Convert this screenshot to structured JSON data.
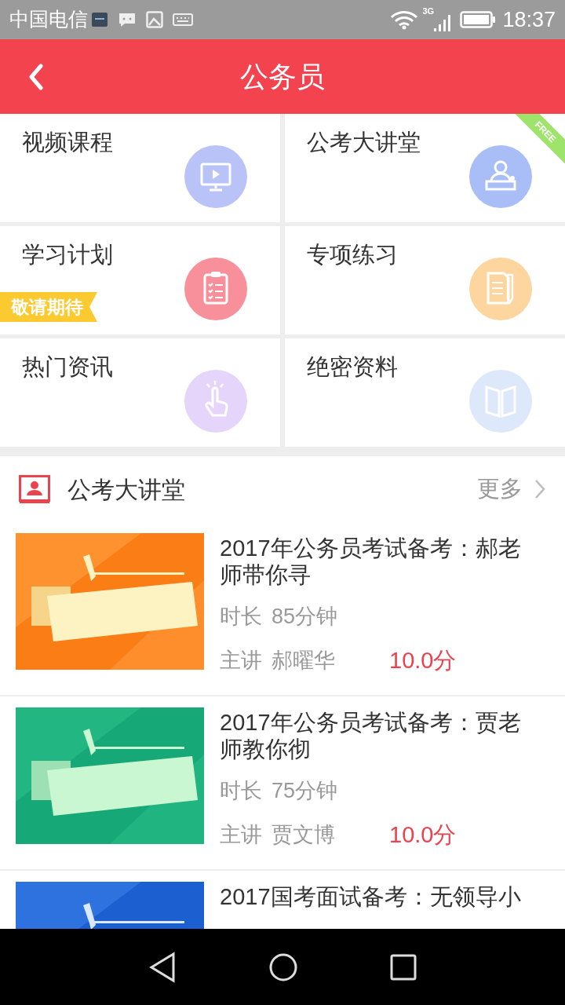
{
  "status_bar": {
    "carrier": "中国电信",
    "network": "3G",
    "time": "18:37"
  },
  "header": {
    "title": "公务员"
  },
  "grid": [
    {
      "label": "视频课程",
      "color": "#b9c3f7"
    },
    {
      "label": "公考大讲堂",
      "color": "#a9bdf6",
      "badge": {
        "kind": "corner",
        "text": "FREE"
      }
    },
    {
      "label": "学习计划",
      "color": "#f7909a",
      "badge": {
        "kind": "ribbon",
        "text": "敬请期待"
      }
    },
    {
      "label": "专项练习",
      "color": "#fdd59f"
    },
    {
      "label": "热门资讯",
      "color": "#e6d5fb"
    },
    {
      "label": "绝密资料",
      "color": "#dde9fb"
    }
  ],
  "section": {
    "title": "公考大讲堂",
    "more": "更多"
  },
  "courses": [
    {
      "title": "2017年公务员考试备考：郝老师带你寻",
      "duration_label": "时长",
      "duration": "85分钟",
      "teacher_label": "主讲",
      "teacher": "郝曜华",
      "score": "10.0分"
    },
    {
      "title": "2017年公务员考试备考：贾老师教你彻",
      "duration_label": "时长",
      "duration": "75分钟",
      "teacher_label": "主讲",
      "teacher": "贾文博",
      "score": "10.0分"
    },
    {
      "title": "2017国考面试备考：无领导小"
    }
  ]
}
